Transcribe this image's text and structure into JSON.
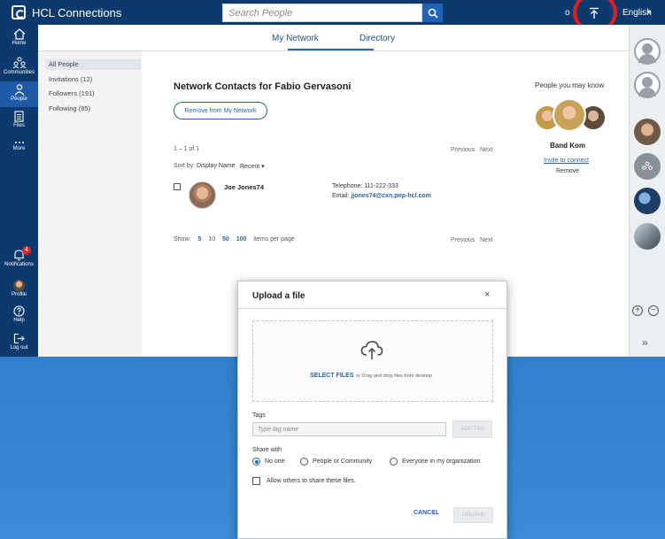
{
  "app": {
    "brand": "HCL Connections"
  },
  "topbar": {
    "search_placeholder": "Search People",
    "initial": "o",
    "language": "English",
    "language_caret": "▾",
    "search_icon": "search-icon",
    "upload_icon": "upload-icon"
  },
  "leftnav": [
    {
      "label": "Home",
      "icon": "home-icon"
    },
    {
      "label": "Communities",
      "icon": "communities-icon"
    },
    {
      "label": "People",
      "icon": "person-icon",
      "active": true
    },
    {
      "label": "Files",
      "icon": "file-icon"
    },
    {
      "label": "More",
      "icon": "more-icon"
    }
  ],
  "leftnav_bottom": {
    "notifications": {
      "label": "Notifications",
      "badge": "4"
    },
    "profile": {
      "label": "Profile"
    },
    "help": {
      "label": "Help"
    },
    "logout": {
      "label": "Log out"
    }
  },
  "tabs": [
    {
      "label": "My Network",
      "active": true
    },
    {
      "label": "Directory"
    }
  ],
  "subnav": [
    {
      "label": "All People",
      "selected": true
    },
    {
      "label": "Invitations (12)"
    },
    {
      "label": "Followers (191)"
    },
    {
      "label": "Following (95)"
    }
  ],
  "main": {
    "title_prefix": "Network Contacts for ",
    "title_name": "Fabio Gervasoni",
    "remove_button": "Remove from My Network",
    "count": "1 – 1 of 1",
    "previous": "Previous",
    "next": "Next",
    "sort_by": "Sort by:",
    "sort_display_name": "Display Name",
    "sort_recent": "Recent ▾",
    "contact": {
      "name": "Joe Jones74",
      "telephone": "Telephone: 111-222-333",
      "email_label": "Email: ",
      "email": "jjones74@cxn.pnp-hcl.com"
    },
    "show_label": "Show:",
    "show_options": [
      "5",
      "10",
      "50",
      "100"
    ],
    "per_page": "items per page"
  },
  "pymk": {
    "title": "People you may know",
    "name": "Band Kom",
    "invite": "Invite to connect",
    "remove": "Remove"
  },
  "modal": {
    "title": "Upload a file",
    "close": "×",
    "select_files": "SELECT FILES",
    "drop_hint": "or Drag and drop files from desktop",
    "tags_label": "Tags",
    "tag_placeholder": "Type tag name",
    "add_tag": "ADD TAG",
    "share_with": "Share with",
    "share_options": [
      {
        "label": "No one",
        "checked": true
      },
      {
        "label": "People or Community",
        "checked": false
      },
      {
        "label": "Everyone in my organization",
        "checked": false
      }
    ],
    "allow_label": "Allow others to share these files.",
    "cancel": "CANCEL",
    "upload": "UPLOAD"
  },
  "rightrail": {
    "zoom_in": "+",
    "zoom_out": "−",
    "expand": "»"
  }
}
